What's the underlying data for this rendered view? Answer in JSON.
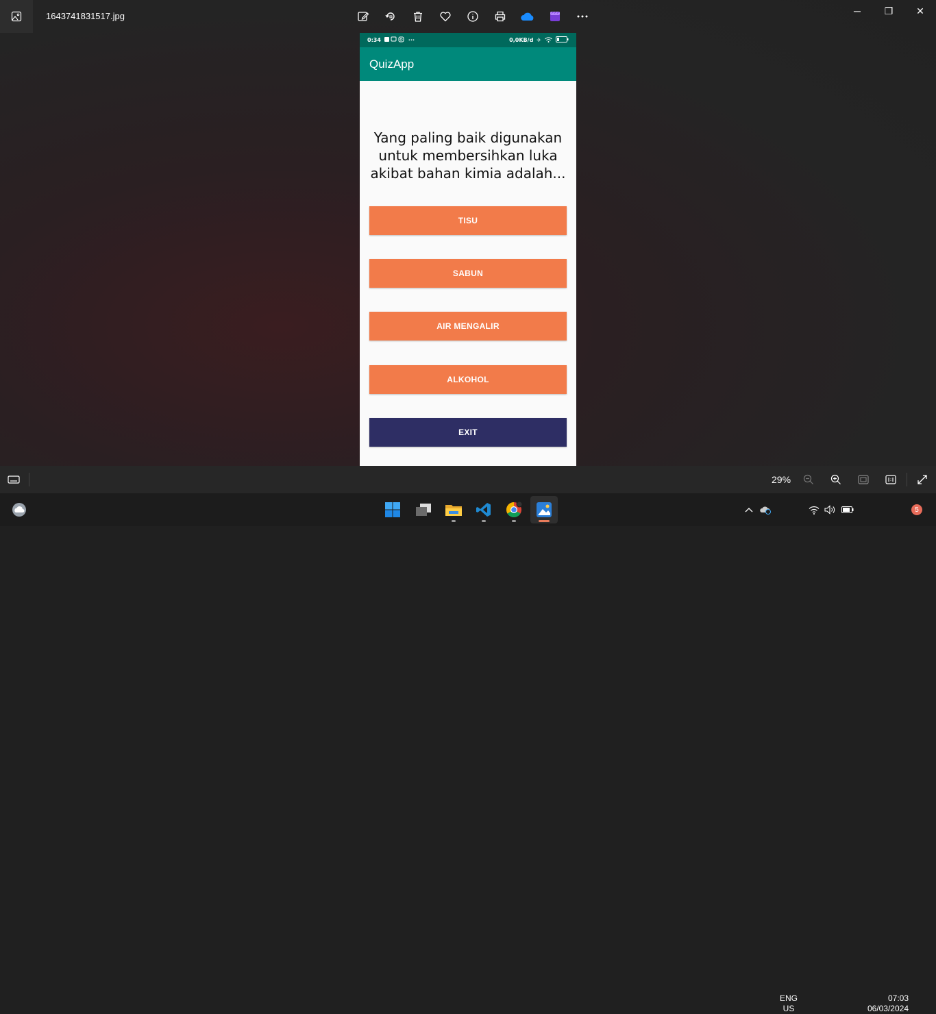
{
  "window": {
    "filename": "1643741831517.jpg",
    "controls": {
      "minimize": "─",
      "restore": "❐",
      "close": "✕"
    }
  },
  "toolbar": {
    "icons": [
      "edit-image-icon",
      "rotate-icon",
      "delete-icon",
      "favorite-icon",
      "info-icon",
      "print-icon",
      "onedrive-icon",
      "clipchamp-icon",
      "more-icon"
    ]
  },
  "phone": {
    "status": {
      "time": "0:34",
      "dots": "···",
      "speed": "0,0KB/d"
    },
    "app_title": "QuizApp",
    "question": "Yang paling baik digunakan untuk membersihkan luka akibat bahan kimia adalah...",
    "answers": [
      "TISU",
      "SABUN",
      "AIR MENGALIR",
      "ALKOHOL"
    ],
    "exit_label": "EXIT",
    "colors": {
      "appbar": "#00897b",
      "statusbar": "#00695c",
      "answer_button": "#f27b4a",
      "exit_button": "#2e2e64"
    }
  },
  "viewbar": {
    "zoom": "29%"
  },
  "taskbar": {
    "lang": "ENG",
    "region": "US",
    "time": "07:03",
    "date": "06/03/2024",
    "notifications": "5"
  }
}
